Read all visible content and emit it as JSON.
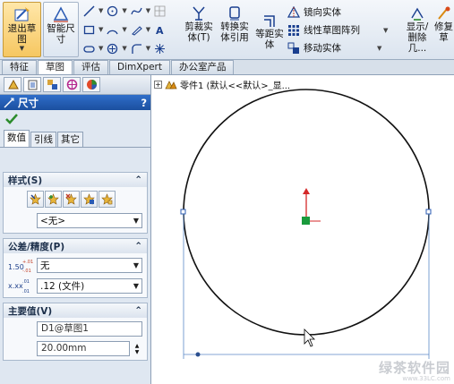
{
  "toolbar": {
    "exit_sketch": "退出草图",
    "smart_dimension": "智能尺寸",
    "trim": "剪裁实体(T)",
    "convert": "转换实体引用",
    "offset": "等距实体",
    "mirror": "镜向实体",
    "linear_pattern": "线性草图阵列",
    "move": "移动实体",
    "display_delete": "显示/删除几...",
    "repair": "修复草"
  },
  "tabs": [
    "特征",
    "草图",
    "评估",
    "DimXpert",
    "办公室产品"
  ],
  "active_tab": 1,
  "panel": {
    "title": "尺寸",
    "help": "?",
    "subtabs": [
      "数值",
      "引线",
      "其它"
    ],
    "style_section": {
      "title": "样式(S)",
      "value": "<无>"
    },
    "tolerance_section": {
      "title": "公差/精度(P)",
      "tolerance_type": "无",
      "precision": ".12 (文件)"
    },
    "primary_section": {
      "title": "主要值(V)",
      "name": "D1@草图1",
      "value": "20.00mm"
    }
  },
  "feature_tree": {
    "label": "零件1 (默认<<默认>_显..."
  },
  "watermark": {
    "line1": "绿茶软件园",
    "line2": "www.33LC.com"
  },
  "colors": {
    "accent_blue": "#1b4f9f",
    "circle": "#111111",
    "dimension_line": "#5b89c9",
    "origin_red": "#d42828",
    "origin_green": "#1a9a3c"
  }
}
